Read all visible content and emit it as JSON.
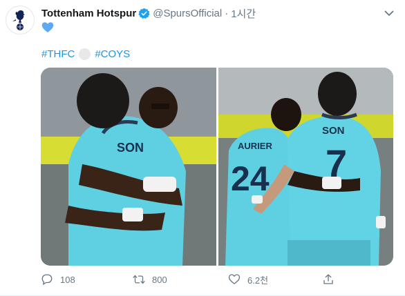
{
  "tweet": {
    "display_name": "Tottenham Hotspur",
    "handle": "@SpursOfficial",
    "separator": "·",
    "time": "1시간",
    "hashtags": [
      "#THFC",
      "#COYS"
    ],
    "photos": [
      {
        "shirt_name": "SON"
      },
      {
        "shirt_name_back": "AURIER",
        "shirt_number_back": "24",
        "shirt_name_front": "SON",
        "shirt_number_front": "7"
      }
    ],
    "actions": {
      "reply_count": "108",
      "retweet_count": "800",
      "like_count": "6.2천"
    }
  },
  "colors": {
    "link": "#1b95e0",
    "verified": "#1da1f2",
    "muted": "#657786",
    "heart": "#5daaf0",
    "kit": "#6ad3e4"
  },
  "icons": [
    "spurs-logo-icon",
    "verified-badge-icon",
    "chevron-down-icon",
    "blue-heart-icon",
    "reply-icon",
    "retweet-icon",
    "like-icon",
    "share-icon"
  ]
}
